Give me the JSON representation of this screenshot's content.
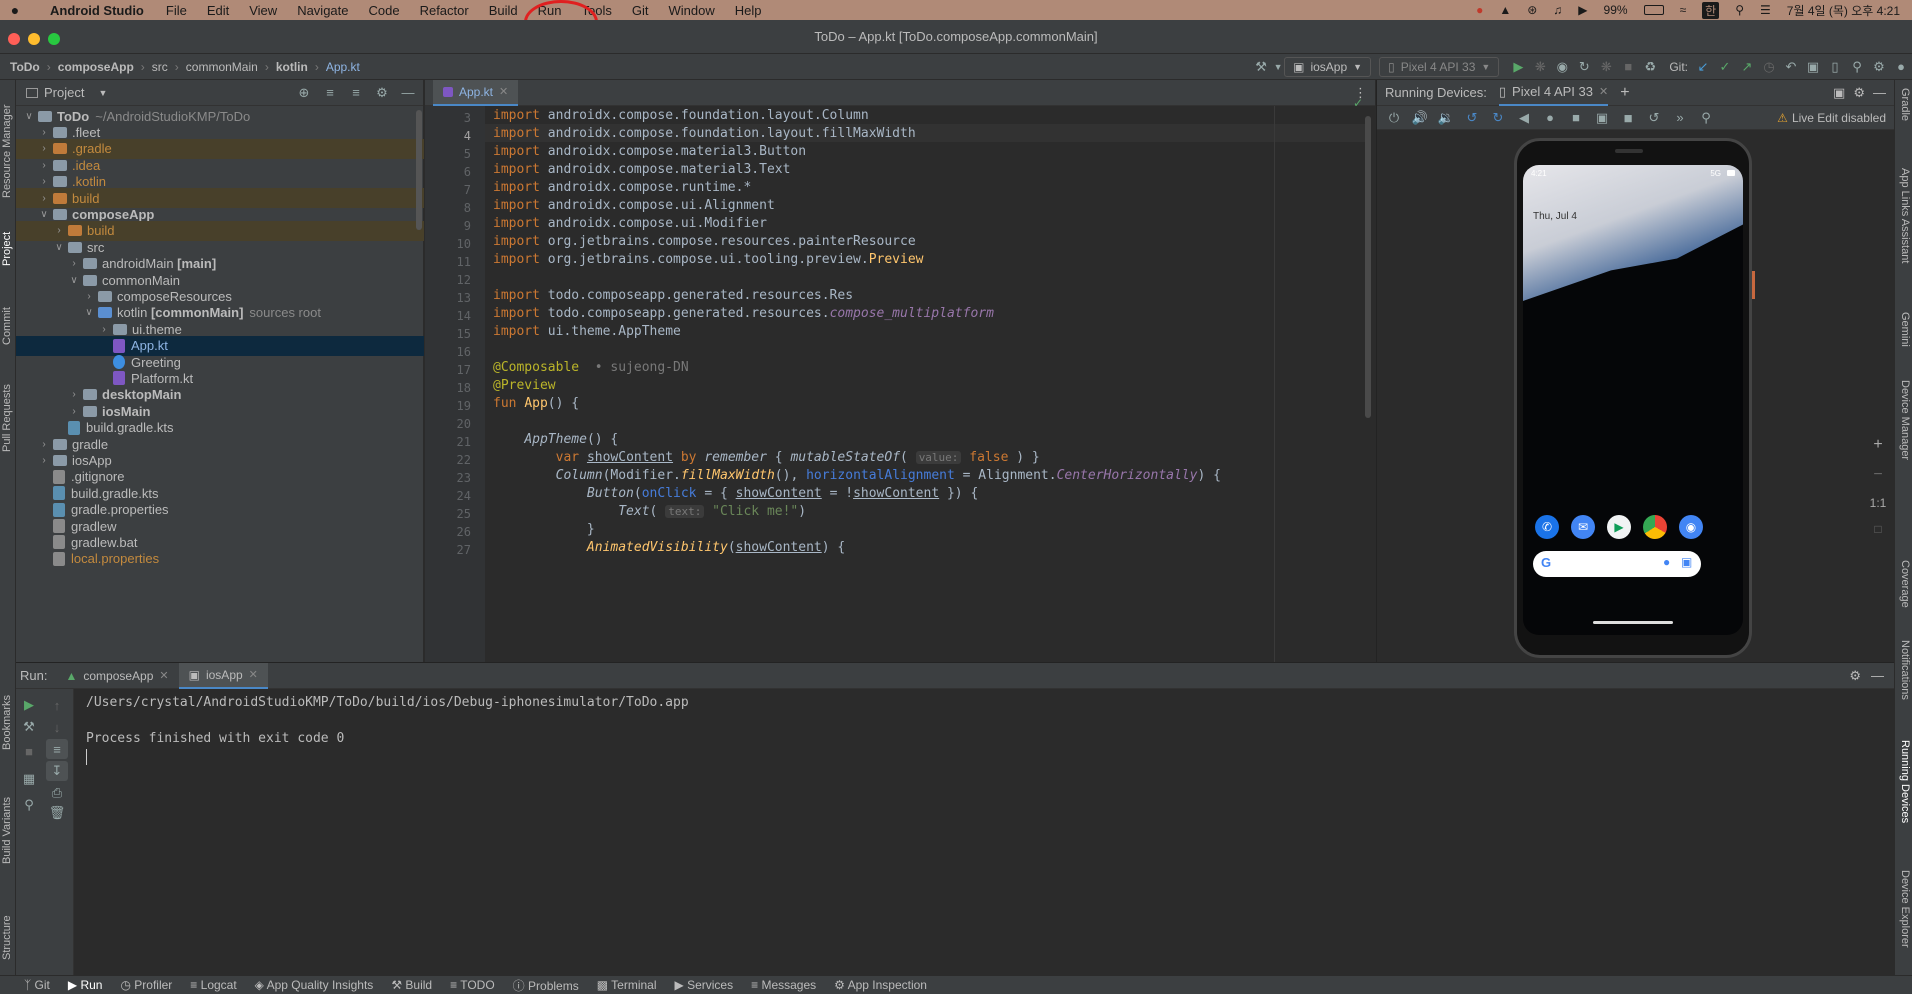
{
  "menubar": {
    "apple": "",
    "app_name": "Android Studio",
    "items": [
      "File",
      "Edit",
      "View",
      "Navigate",
      "Code",
      "Refactor",
      "Build",
      "Run",
      "Tools",
      "Git",
      "Window",
      "Help"
    ],
    "battery": "99%",
    "ime": "한",
    "datetime": "7월 4일 (목) 오후 4:21"
  },
  "window": {
    "title": "ToDo – App.kt [ToDo.composeApp.commonMain]"
  },
  "nav": {
    "crumbs": [
      "ToDo",
      "composeApp",
      "src",
      "commonMain",
      "kotlin",
      "App.kt"
    ],
    "run_config": "iosApp",
    "device": "Pixel 4 API 33",
    "git_label": "Git:"
  },
  "left_strip": [
    "Resource Manager",
    "Project",
    "Commit",
    "Pull Requests",
    "Bookmarks",
    "Build Variants",
    "Structure"
  ],
  "right_strip": [
    "Gradle",
    "App Links Assistant",
    "Gemini",
    "Device Manager",
    "Coverage",
    "Notifications",
    "Running Devices",
    "Device Explorer"
  ],
  "project": {
    "title": "Project",
    "tree": [
      {
        "label": "ToDo",
        "extra": "~/AndroidStudioKMP/ToDo",
        "indent": 0,
        "arrow": "open",
        "icon": "folder",
        "bold": true
      },
      {
        "label": ".fleet",
        "indent": 1,
        "arrow": "closed",
        "icon": "folder"
      },
      {
        "label": ".gradle",
        "indent": 1,
        "arrow": "closed",
        "icon": "folder-orange",
        "color": "orange",
        "hl": true
      },
      {
        "label": ".idea",
        "indent": 1,
        "arrow": "closed",
        "icon": "folder",
        "color": "orange"
      },
      {
        "label": ".kotlin",
        "indent": 1,
        "arrow": "closed",
        "icon": "folder",
        "color": "orange"
      },
      {
        "label": "build",
        "indent": 1,
        "arrow": "closed",
        "icon": "folder-orange",
        "color": "orange",
        "hl": true
      },
      {
        "label": "composeApp",
        "indent": 1,
        "arrow": "open",
        "icon": "folder",
        "bold": true
      },
      {
        "label": "build",
        "indent": 2,
        "arrow": "closed",
        "icon": "folder-orange",
        "color": "orange",
        "hl": true
      },
      {
        "label": "src",
        "indent": 2,
        "arrow": "open",
        "icon": "folder"
      },
      {
        "label": "androidMain [main]",
        "indent": 3,
        "arrow": "closed",
        "icon": "folder"
      },
      {
        "label": "commonMain",
        "indent": 3,
        "arrow": "open",
        "icon": "folder"
      },
      {
        "label": "composeResources",
        "indent": 4,
        "arrow": "closed",
        "icon": "folder"
      },
      {
        "label": "kotlin [commonMain]",
        "extra": "sources root",
        "indent": 4,
        "arrow": "open",
        "icon": "folder-blue"
      },
      {
        "label": "ui.theme",
        "indent": 5,
        "arrow": "closed",
        "icon": "folder"
      },
      {
        "label": "App.kt",
        "indent": 5,
        "arrow": "none",
        "icon": "kotlin",
        "selected": true
      },
      {
        "label": "Greeting",
        "indent": 5,
        "arrow": "none",
        "icon": "class"
      },
      {
        "label": "Platform.kt",
        "indent": 5,
        "arrow": "none",
        "icon": "kotlin"
      },
      {
        "label": "desktopMain",
        "indent": 3,
        "arrow": "closed",
        "icon": "folder",
        "bold": true
      },
      {
        "label": "iosMain",
        "indent": 3,
        "arrow": "closed",
        "icon": "folder",
        "bold": true
      },
      {
        "label": "build.gradle.kts",
        "indent": 2,
        "arrow": "none",
        "icon": "gradle"
      },
      {
        "label": "gradle",
        "indent": 1,
        "arrow": "closed",
        "icon": "folder"
      },
      {
        "label": "iosApp",
        "indent": 1,
        "arrow": "closed",
        "icon": "folder"
      },
      {
        "label": ".gitignore",
        "indent": 1,
        "arrow": "none",
        "icon": "file"
      },
      {
        "label": "build.gradle.kts",
        "indent": 1,
        "arrow": "none",
        "icon": "gradle"
      },
      {
        "label": "gradle.properties",
        "indent": 1,
        "arrow": "none",
        "icon": "gradle"
      },
      {
        "label": "gradlew",
        "indent": 1,
        "arrow": "none",
        "icon": "file"
      },
      {
        "label": "gradlew.bat",
        "indent": 1,
        "arrow": "none",
        "icon": "file"
      },
      {
        "label": "local.properties",
        "indent": 1,
        "arrow": "none",
        "icon": "file",
        "color": "orange"
      }
    ]
  },
  "editor": {
    "tab": "App.kt",
    "line_numbers": [
      "3",
      "4",
      "5",
      "6",
      "7",
      "8",
      "9",
      "10",
      "11",
      "12",
      "13",
      "14",
      "15",
      "16",
      "17",
      "18",
      "19",
      "20",
      "21",
      "22",
      "23",
      "24",
      "25",
      "26",
      "27"
    ],
    "author_hint": "sujeong-DN",
    "hint_value": "value:",
    "hint_text": "text:",
    "l3": "androidx.compose.foundation.layout.Column",
    "l4": "androidx.compose.foundation.layout.fillMaxWidth",
    "l5": "androidx.compose.material3.Button",
    "l6": "androidx.compose.material3.Text",
    "l7": "androidx.compose.runtime.*",
    "l8": "androidx.compose.ui.Alignment",
    "l9": "androidx.compose.ui.Modifier",
    "l10": "org.jetbrains.compose.resources.painterResource",
    "l11a": "org.jetbrains.compose.ui.tooling.preview.",
    "l11b": "Preview",
    "l13": "todo.composeapp.generated.resources.Res",
    "l14a": "todo.composeapp.generated.resources.",
    "l14b": "compose_multiplatform",
    "l15": "ui.theme.AppTheme",
    "import": "import"
  },
  "devices": {
    "title": "Running Devices:",
    "tab": "Pixel 4 API 33",
    "live_edit": "Live Edit disabled",
    "zoom": "1:1",
    "phone_time": "4:21",
    "phone_net": "5G",
    "phone_date": "Thu, Jul 4"
  },
  "run": {
    "label": "Run:",
    "tabs": [
      "composeApp",
      "iosApp"
    ],
    "lines": [
      "/Users/crystal/AndroidStudioKMP/ToDo/build/ios/Debug-iphonesimulator/ToDo.app",
      "",
      "Process finished with exit code 0"
    ]
  },
  "statusbar": [
    "Git",
    "Run",
    "Profiler",
    "Logcat",
    "App Quality Insights",
    "Build",
    "TODO",
    "Problems",
    "Terminal",
    "Services",
    "Messages",
    "App Inspection"
  ]
}
